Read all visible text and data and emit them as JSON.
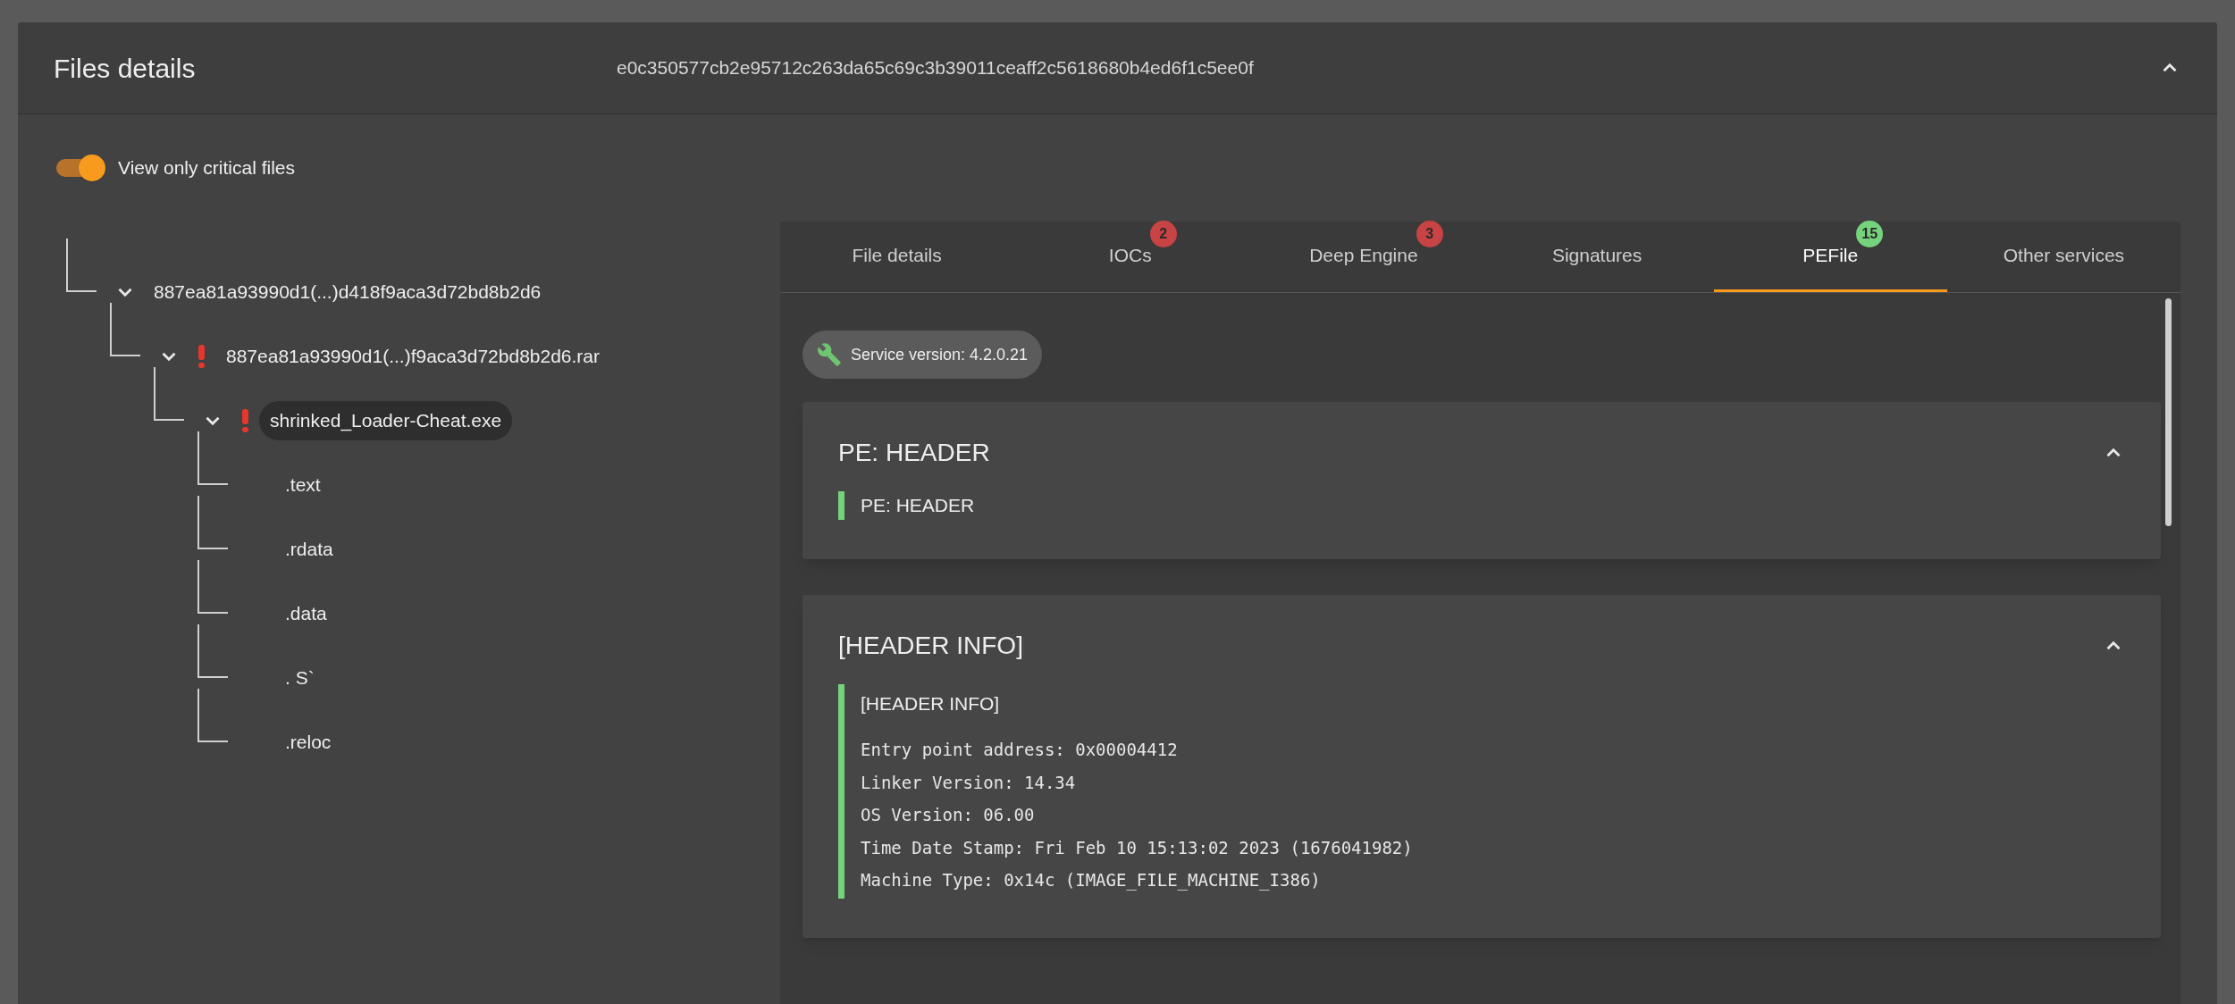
{
  "panel": {
    "title": "Files details",
    "hash": "e0c350577cb2e95712c263da65c69c3b39011ceaff2c5618680b4ed6f1c5ee0f",
    "expanded": true
  },
  "critical_toggle": {
    "label": "View only critical files",
    "on": true
  },
  "tree": [
    {
      "label": "887ea81a93990d1(...)d418f9aca3d72bd8b2d6",
      "critical": false,
      "expanded": true,
      "selected": false,
      "children": [
        {
          "label": "887ea81a93990d1(...)f9aca3d72bd8b2d6.rar",
          "critical": true,
          "expanded": true,
          "selected": false,
          "children": [
            {
              "label": "shrinked_Loader-Cheat.exe",
              "critical": true,
              "expanded": true,
              "selected": true,
              "children": [
                {
                  "label": ".text",
                  "critical": false,
                  "selected": false
                },
                {
                  "label": ".rdata",
                  "critical": false,
                  "selected": false
                },
                {
                  "label": ".data",
                  "critical": false,
                  "selected": false
                },
                {
                  "label": ". S`",
                  "critical": false,
                  "selected": false
                },
                {
                  "label": ".reloc",
                  "critical": false,
                  "selected": false
                }
              ]
            }
          ]
        }
      ]
    }
  ],
  "tabs": [
    {
      "label": "File details",
      "selected": false
    },
    {
      "label": "IOCs",
      "selected": false,
      "badge": "2",
      "color": "#c84343"
    },
    {
      "label": "Deep Engine",
      "selected": false,
      "badge": "3",
      "color": "#c84343"
    },
    {
      "label": "Signatures",
      "selected": false
    },
    {
      "label": "PEFile",
      "selected": true,
      "badge": "15",
      "color": "#74d37c"
    },
    {
      "label": "Other services",
      "selected": false
    }
  ],
  "service_version": "Service version: 4.2.0.21",
  "sections": [
    {
      "title": "PE: HEADER",
      "expanded": true,
      "heading": "PE: HEADER"
    },
    {
      "title": "[HEADER INFO]",
      "expanded": true,
      "heading": "[HEADER INFO]",
      "lines": [
        "Entry point address: 0x00004412",
        "Linker Version: 14.34",
        "OS Version: 06.00",
        "Time Date Stamp: Fri Feb 10 15:13:02 2023 (1676041982)",
        "Machine Type: 0x14c (IMAGE_FILE_MACHINE_I386)"
      ]
    }
  ]
}
